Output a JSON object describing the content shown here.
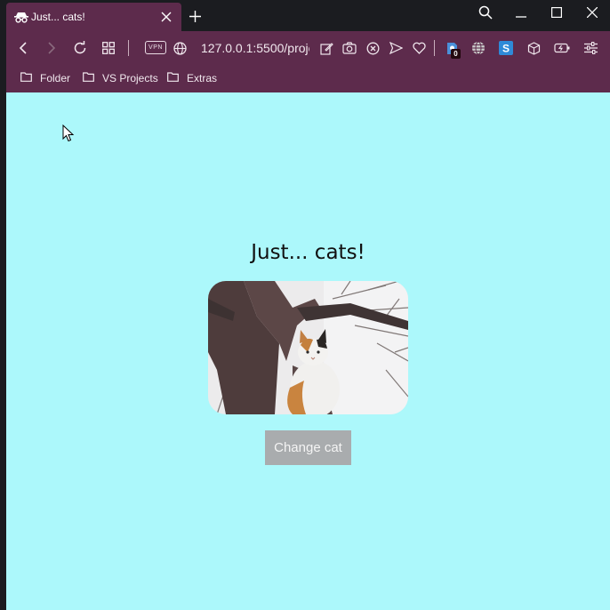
{
  "browser": {
    "tab": {
      "title": "Just... cats!",
      "icon": "incognito-icon"
    },
    "toolbar": {
      "vpn_label": "VPN",
      "url": "127.0.0.1:5500/proje",
      "extension_badge": "0"
    },
    "bookmarks": [
      {
        "label": "Folder",
        "icon": "folder-icon"
      },
      {
        "label": "VS Projects",
        "icon": "folder-icon"
      },
      {
        "label": "Extras",
        "icon": "folder-icon"
      }
    ],
    "colors": {
      "chrome": "#5d2b4c",
      "titlebar": "#1b1c20",
      "page_background": "#acf8fb",
      "button": "#a9acae"
    }
  },
  "page": {
    "heading": "Just... cats!",
    "image_alt": "cat sitting in a tree",
    "button_label": "Change cat"
  }
}
